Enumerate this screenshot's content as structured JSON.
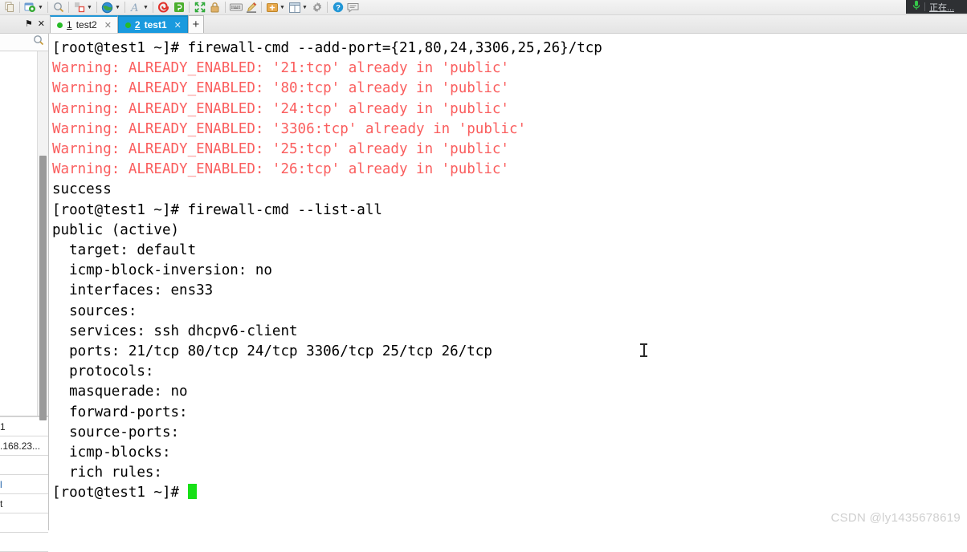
{
  "toolbar": {
    "items": [
      {
        "name": "copy-icon",
        "glyph": "copy",
        "caret": false
      },
      {
        "name": "session-settings-icon",
        "glyph": "gear-green",
        "caret": true
      },
      {
        "name": "search-icon",
        "glyph": "magnifier",
        "caret": false
      },
      {
        "name": "transfer-icon",
        "glyph": "transfer",
        "caret": true
      },
      {
        "name": "globe-icon",
        "glyph": "globe",
        "caret": true
      },
      {
        "name": "font-icon",
        "glyph": "font-a",
        "caret": true
      },
      {
        "name": "spiral-icon",
        "glyph": "spiral",
        "caret": false
      },
      {
        "name": "upload-icon",
        "glyph": "green-box",
        "caret": false
      },
      {
        "name": "fullscreen-icon",
        "glyph": "expand",
        "caret": false
      },
      {
        "name": "lock-icon",
        "glyph": "lock",
        "caret": false
      },
      {
        "name": "keyboard-icon",
        "glyph": "keyboard",
        "caret": false
      },
      {
        "name": "highlighter-icon",
        "glyph": "pen",
        "caret": false
      },
      {
        "name": "new-folder-icon",
        "glyph": "folder-plus",
        "caret": true
      },
      {
        "name": "layout-icon",
        "glyph": "layout",
        "caret": true
      },
      {
        "name": "settings-icon",
        "glyph": "gear-grey",
        "caret": false
      },
      {
        "name": "help-icon",
        "glyph": "help",
        "caret": false
      },
      {
        "name": "feedback-icon",
        "glyph": "chat",
        "caret": false
      }
    ]
  },
  "tabbar": {
    "pin_glyph": "⚑",
    "close_glyph": "✕",
    "tabs": [
      {
        "num": "1",
        "title": "test2",
        "active": false,
        "close": "✕"
      },
      {
        "num": "2",
        "title": "test1",
        "active": true,
        "close": "✕"
      }
    ],
    "new_tab_label": "+"
  },
  "sidebar": {
    "search_icon": "magnifier",
    "rows": [
      {
        "label": "1",
        "style": "plain"
      },
      {
        "label": ".168.23...",
        "style": "plain"
      },
      {
        "label": "",
        "style": "blank"
      },
      {
        "label": "l",
        "style": "link"
      },
      {
        "label": "t",
        "style": "plain"
      },
      {
        "label": "",
        "style": "blank"
      },
      {
        "label": "",
        "style": "blank"
      }
    ]
  },
  "terminal": {
    "lines": [
      {
        "text": "[root@test1 ~]# firewall-cmd --add-port={21,80,24,3306,25,26}/tcp",
        "type": "normal"
      },
      {
        "text": "Warning: ALREADY_ENABLED: '21:tcp' already in 'public'",
        "type": "warn"
      },
      {
        "text": "Warning: ALREADY_ENABLED: '80:tcp' already in 'public'",
        "type": "warn"
      },
      {
        "text": "Warning: ALREADY_ENABLED: '24:tcp' already in 'public'",
        "type": "warn"
      },
      {
        "text": "Warning: ALREADY_ENABLED: '3306:tcp' already in 'public'",
        "type": "warn"
      },
      {
        "text": "Warning: ALREADY_ENABLED: '25:tcp' already in 'public'",
        "type": "warn"
      },
      {
        "text": "Warning: ALREADY_ENABLED: '26:tcp' already in 'public'",
        "type": "warn"
      },
      {
        "text": "success",
        "type": "normal"
      },
      {
        "text": "[root@test1 ~]# firewall-cmd --list-all",
        "type": "normal"
      },
      {
        "text": "public (active)",
        "type": "normal"
      },
      {
        "text": "  target: default",
        "type": "normal"
      },
      {
        "text": "  icmp-block-inversion: no",
        "type": "normal"
      },
      {
        "text": "  interfaces: ens33",
        "type": "normal"
      },
      {
        "text": "  sources:",
        "type": "normal"
      },
      {
        "text": "  services: ssh dhcpv6-client",
        "type": "normal"
      },
      {
        "text": "  ports: 21/tcp 80/tcp 24/tcp 3306/tcp 25/tcp 26/tcp",
        "type": "normal"
      },
      {
        "text": "  protocols:",
        "type": "normal"
      },
      {
        "text": "  masquerade: no",
        "type": "normal"
      },
      {
        "text": "  forward-ports:",
        "type": "normal"
      },
      {
        "text": "  source-ports:",
        "type": "normal"
      },
      {
        "text": "  icmp-blocks:",
        "type": "normal"
      },
      {
        "text": "  rich rules:",
        "type": "normal"
      },
      {
        "text": "",
        "type": "normal"
      },
      {
        "text": "[root@test1 ~]# ",
        "type": "prompt"
      }
    ],
    "cursor_color": "#17e017",
    "warn_color": "#fa5e5e"
  },
  "ime_panel": {
    "mic_icon": "microphone",
    "label": "正在..."
  },
  "watermark": {
    "text": "CSDN @ly1435678619"
  }
}
